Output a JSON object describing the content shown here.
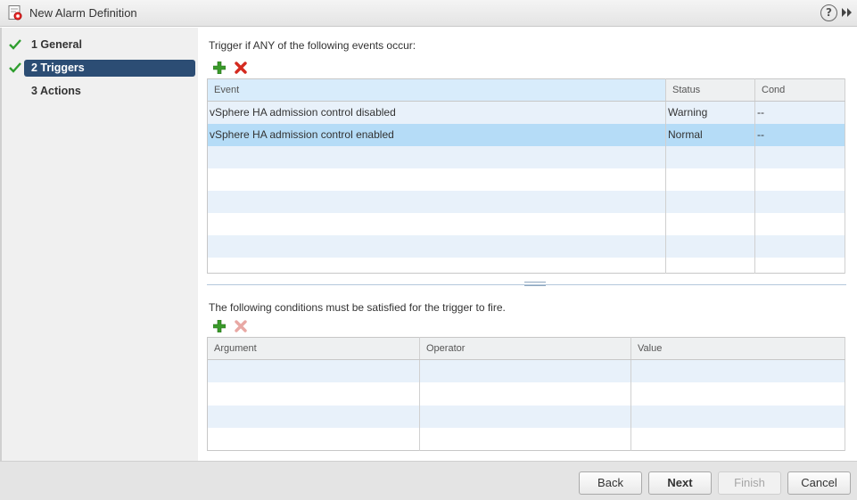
{
  "window": {
    "title": "New Alarm Definition",
    "help_glyph": "?"
  },
  "steps": [
    {
      "label": "1 General",
      "done": true
    },
    {
      "label": "2 Triggers",
      "done": true,
      "active": true
    },
    {
      "label": "3 Actions",
      "done": false
    }
  ],
  "triggers": {
    "prompt": "Trigger if ANY of the following events occur:",
    "columns": [
      "Event",
      "Status",
      "Cond"
    ],
    "rows": [
      {
        "event": "vSphere HA admission control disabled",
        "status": "Warning",
        "cond": "--"
      },
      {
        "event": "vSphere HA admission control enabled",
        "status": "Normal",
        "cond": "--"
      }
    ],
    "selected_row": 1
  },
  "conditions": {
    "prompt": "The following conditions must be satisfied for the trigger to fire.",
    "columns": [
      "Argument",
      "Operator",
      "Value"
    ]
  },
  "footer": {
    "back": "Back",
    "next": "Next",
    "finish": "Finish",
    "cancel": "Cancel"
  },
  "icons": {
    "add": "plus-icon",
    "remove": "delete-x-icon",
    "done": "checkmark-icon",
    "alarm": "alarm-definition-icon"
  },
  "colors": {
    "active_step": "#2c4d74",
    "selected_row": "#b5dcf7",
    "add_icon": "#3a9a2a",
    "remove_icon": "#d42a1f"
  }
}
